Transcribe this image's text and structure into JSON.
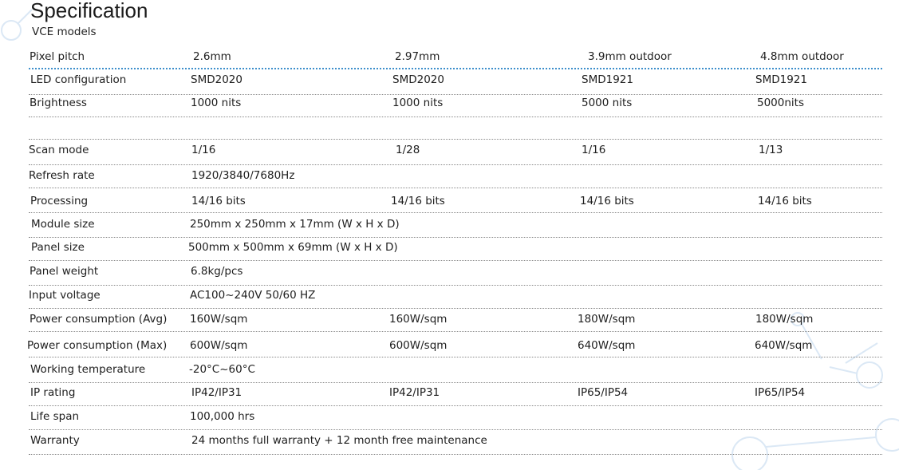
{
  "page": {
    "title": "Specification",
    "subtitle": "VCE models",
    "accent_color": "#3d8fcc"
  },
  "spec_table": {
    "rows": [
      {
        "label": "Pixel pitch",
        "values": [
          "2.6mm",
          "2.97mm",
          "3.9mm outdoor",
          "4.8mm outdoor"
        ]
      },
      {
        "label": "LED configuration",
        "values": [
          "SMD2020",
          "SMD2020",
          "SMD1921",
          "SMD1921"
        ]
      },
      {
        "label": "Brightness",
        "values": [
          "1000 nits",
          "1000 nits",
          "5000 nits",
          "5000nits"
        ]
      },
      {
        "label": "Scan mode",
        "values": [
          "1/16",
          "1/28",
          "1/16",
          "1/13"
        ]
      },
      {
        "label": "Refresh rate",
        "values": [
          "1920/3840/7680Hz"
        ]
      },
      {
        "label": "Processing",
        "values": [
          "14/16 bits",
          "14/16 bits",
          "14/16 bits",
          "14/16 bits"
        ]
      },
      {
        "label": "Module size",
        "values": [
          "250mm x 250mm x 17mm (W x H x D)"
        ]
      },
      {
        "label": "Panel size",
        "values": [
          "500mm x 500mm x 69mm (W x H x D)"
        ]
      },
      {
        "label": "Panel weight",
        "values": [
          "6.8kg/pcs"
        ]
      },
      {
        "label": "Input voltage",
        "values": [
          "AC100~240V 50/60 HZ"
        ]
      },
      {
        "label": "Power consumption (Avg)",
        "values": [
          "160W/sqm",
          "160W/sqm",
          "180W/sqm",
          "180W/sqm"
        ]
      },
      {
        "label": "Power consumption (Max)",
        "values": [
          "600W/sqm",
          "600W/sqm",
          "640W/sqm",
          "640W/sqm"
        ]
      },
      {
        "label": "Working temperature",
        "values": [
          "-20°C~60°C"
        ]
      },
      {
        "label": "IP rating",
        "values": [
          "IP42/IP31",
          "IP42/IP31",
          "IP65/IP54",
          "IP65/IP54"
        ]
      },
      {
        "label": "Life span",
        "values": [
          "100,000 hrs"
        ]
      },
      {
        "label": "Warranty",
        "values": [
          "24 months full warranty + 12 month free maintenance"
        ]
      }
    ]
  }
}
